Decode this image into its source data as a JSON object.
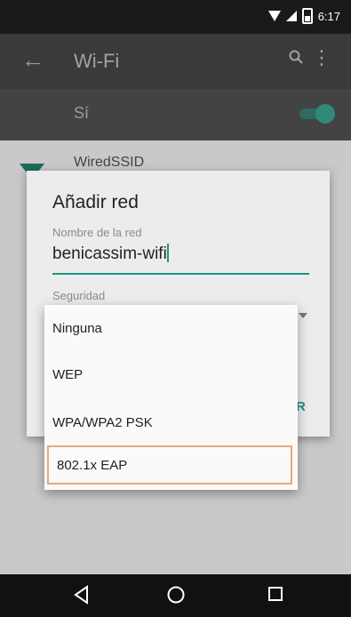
{
  "status_bar": {
    "time": "6:17"
  },
  "app_bar": {
    "title": "Wi-Fi"
  },
  "wifi_toggle": {
    "label": "Sí",
    "on": true
  },
  "network_list": [
    {
      "ssid": "WiredSSID"
    }
  ],
  "dialog": {
    "title": "Añadir red",
    "network_name_label": "Nombre de la red",
    "network_name_value": "benicassim-wifi",
    "security_label": "Seguridad",
    "action_partial": "R"
  },
  "security_dropdown": {
    "options": [
      "Ninguna",
      "WEP",
      "WPA/WPA2 PSK",
      "802.1x EAP"
    ],
    "highlighted": "802.1x EAP"
  },
  "colors": {
    "accent": "#1e9481",
    "highlight_border": "#e8a77b"
  }
}
